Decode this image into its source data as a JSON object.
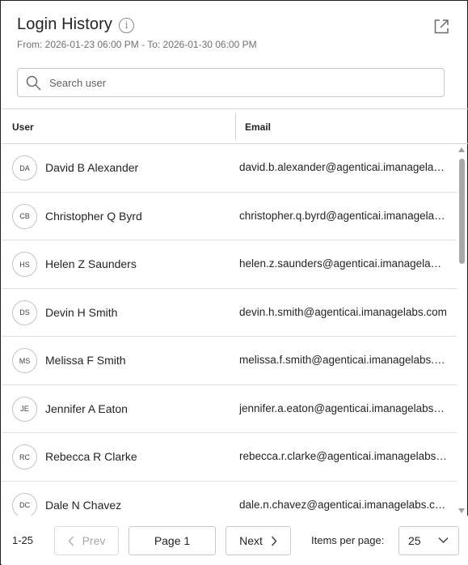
{
  "header": {
    "title": "Login History",
    "info_icon": "info-icon",
    "date_range": "From: 2026-01-23 06:00 PM - To: 2026-01-30 06:00 PM",
    "popout_icon": "external-link-icon"
  },
  "search": {
    "placeholder": "Search user",
    "value": ""
  },
  "table": {
    "columns": [
      "User",
      "Email"
    ],
    "rows": [
      {
        "initials": "DA",
        "name": "David B Alexander",
        "email": "david.b.alexander@agenticai.imanagelabs.com"
      },
      {
        "initials": "CB",
        "name": "Christopher Q Byrd",
        "email": "christopher.q.byrd@agenticai.imanagelabs.com"
      },
      {
        "initials": "HS",
        "name": "Helen Z Saunders",
        "email": "helen.z.saunders@agenticai.imanagelabs.com"
      },
      {
        "initials": "DS",
        "name": "Devin H Smith",
        "email": "devin.h.smith@agenticai.imanagelabs.com"
      },
      {
        "initials": "MS",
        "name": "Melissa F Smith",
        "email": "melissa.f.smith@agenticai.imanagelabs.com"
      },
      {
        "initials": "JE",
        "name": "Jennifer A Eaton",
        "email": "jennifer.a.eaton@agenticai.imanagelabs.com"
      },
      {
        "initials": "RC",
        "name": "Rebecca R Clarke",
        "email": "rebecca.r.clarke@agenticai.imanagelabs.com"
      },
      {
        "initials": "DC",
        "name": "Dale N Chavez",
        "email": "dale.n.chavez@agenticai.imanagelabs.com"
      }
    ]
  },
  "footer": {
    "range": "1-25",
    "prev_label": "Prev",
    "page_label": "Page 1",
    "next_label": "Next",
    "items_per_page_label": "Items per page:",
    "items_per_page_value": "25"
  }
}
